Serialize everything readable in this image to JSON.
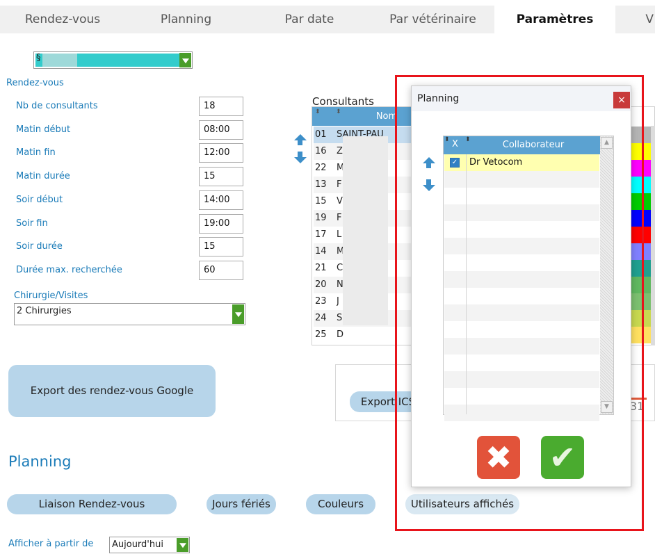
{
  "tabs": [
    {
      "label": "Rendez-vous",
      "active": false
    },
    {
      "label": "Planning",
      "active": false
    },
    {
      "label": "Par date",
      "active": false
    },
    {
      "label": "Par vétérinaire",
      "active": false
    },
    {
      "label": "Paramètres",
      "active": true
    },
    {
      "label": "V",
      "active": false
    }
  ],
  "top_combo": {
    "value": "§"
  },
  "rdv_section": {
    "title": "Rendez-vous",
    "fields": [
      {
        "label": "Nb de consultants",
        "value": "18"
      },
      {
        "label": "Matin début",
        "value": "08:00"
      },
      {
        "label": "Matin fin",
        "value": "12:00"
      },
      {
        "label": "Matin durée",
        "value": "15"
      },
      {
        "label": "Soir début",
        "value": "14:00"
      },
      {
        "label": "Soir fin",
        "value": "19:00"
      },
      {
        "label": "Soir durée",
        "value": "15"
      },
      {
        "label": "Durée max. recherchée",
        "value": "60"
      }
    ],
    "chirurgie_label": "Chirurgie/Visites",
    "chirurgie_value": "2 Chirurgies"
  },
  "export_google_label": "Export des rendez-vous Google",
  "export_ics_label": "Export ICS",
  "calendar_day": "31",
  "consultants": {
    "title": "Consultants",
    "column_name": "Nom",
    "rows": [
      {
        "num": "01",
        "name": "SAINT-PAU"
      },
      {
        "num": "16",
        "name": "Z"
      },
      {
        "num": "22",
        "name": "M"
      },
      {
        "num": "13",
        "name": "F"
      },
      {
        "num": "15",
        "name": "V"
      },
      {
        "num": "19",
        "name": "F"
      },
      {
        "num": "17",
        "name": "L"
      },
      {
        "num": "14",
        "name": "M"
      },
      {
        "num": "21",
        "name": "C"
      },
      {
        "num": "20",
        "name": "N"
      },
      {
        "num": "23",
        "name": "J"
      },
      {
        "num": "24",
        "name": "S"
      },
      {
        "num": "25",
        "name": "D"
      }
    ],
    "colors": [
      "#b5b5b5",
      "#ffff00",
      "#ff00ff",
      "#00ffff",
      "#00cc00",
      "#0000ff",
      "#ff0000",
      "#8080ff",
      "#20a090",
      "#60b860",
      "#7cc070",
      "#c8d850",
      "#ffe060"
    ]
  },
  "planning_section": {
    "title": "Planning",
    "buttons": [
      "Liaison Rendez-vous",
      "Jours fériés",
      "Couleurs",
      "Utilisateurs affichés"
    ],
    "afficher_label": "Afficher à partir de",
    "afficher_value": "Aujourd'hui"
  },
  "dialog": {
    "title": "Planning",
    "close_glyph": "×",
    "col_x": "X",
    "col_collab": "Collaborateur",
    "rows": [
      {
        "checked": true,
        "name": "Dr Vetocom"
      }
    ],
    "cancel_glyph": "✖",
    "ok_glyph": "✔"
  }
}
